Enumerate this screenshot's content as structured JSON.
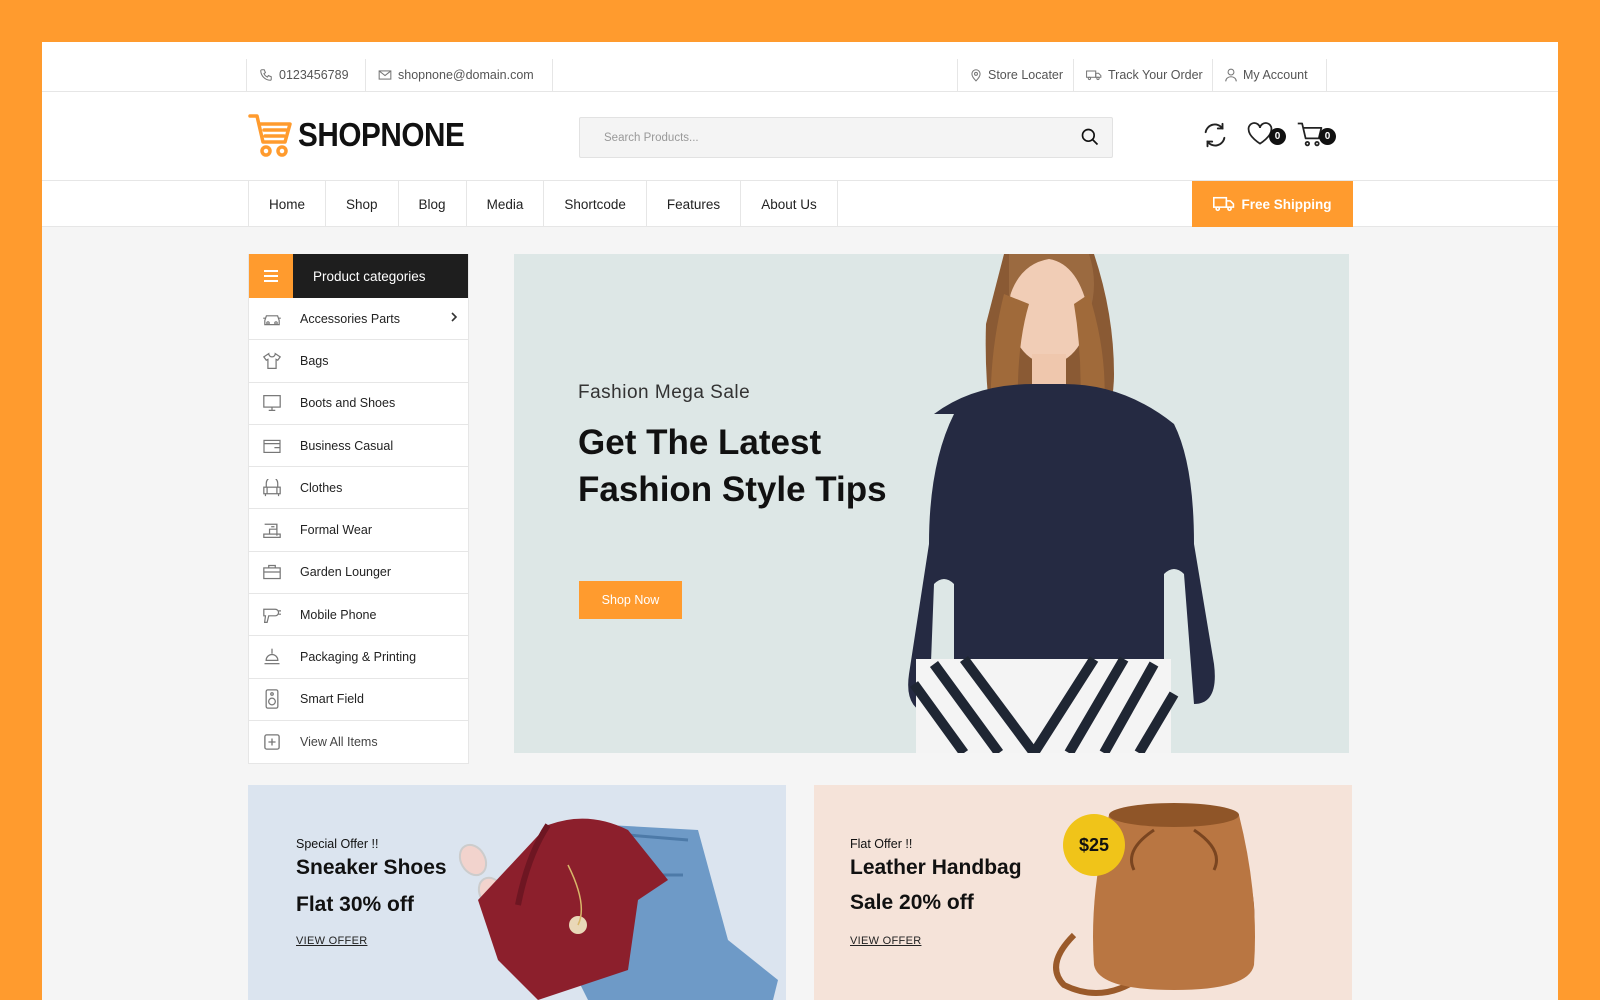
{
  "topbar": {
    "phone": "0123456789",
    "email": "shopnone@domain.com",
    "store_locator": "Store Locater",
    "track_order": "Track Your Order",
    "my_account": "My Account"
  },
  "header": {
    "logo": "SHOPNONE",
    "search_placeholder": "Search Products...",
    "wishlist_count": "0",
    "cart_count": "0"
  },
  "nav": {
    "items": [
      "Home",
      "Shop",
      "Blog",
      "Media",
      "Shortcode",
      "Features",
      "About Us"
    ],
    "free_shipping": "Free Shipping"
  },
  "categories": {
    "title": "Product categories",
    "items": [
      {
        "label": "Accessories Parts",
        "icon": "car-icon"
      },
      {
        "label": "Bags",
        "icon": "tshirt-icon"
      },
      {
        "label": "Boots and Shoes",
        "icon": "monitor-icon"
      },
      {
        "label": "Business Casual",
        "icon": "wallet-icon"
      },
      {
        "label": "Clothes",
        "icon": "sofa-icon"
      },
      {
        "label": "Formal Wear",
        "icon": "sewing-machine-icon"
      },
      {
        "label": "Garden Lounger",
        "icon": "briefcase-icon"
      },
      {
        "label": "Mobile Phone",
        "icon": "hair-dryer-icon"
      },
      {
        "label": "Packaging & Printing",
        "icon": "lamp-icon"
      },
      {
        "label": "Smart Field",
        "icon": "speaker-icon"
      },
      {
        "label": "View All Items",
        "icon": "plus-icon"
      }
    ]
  },
  "hero": {
    "subtitle": "Fashion Mega Sale",
    "title_line1": "Get The Latest",
    "title_line2": "Fashion Style Tips",
    "button": "Shop Now"
  },
  "banners": [
    {
      "kicker": "Special Offer !!",
      "title": "Sneaker Shoes",
      "offer": "Flat 30% off",
      "link": "VIEW OFFER"
    },
    {
      "kicker": "Flat Offer !!",
      "title": "Leather Handbag",
      "offer": "Sale 20% off",
      "link": "VIEW OFFER",
      "price": "$25"
    }
  ],
  "colors": {
    "accent": "#ff9b2e",
    "dark": "#1e1e1e",
    "hero_bg": "#dde7e6",
    "banner1_bg": "#dbe4ef",
    "banner2_bg": "#f5e3d9"
  }
}
